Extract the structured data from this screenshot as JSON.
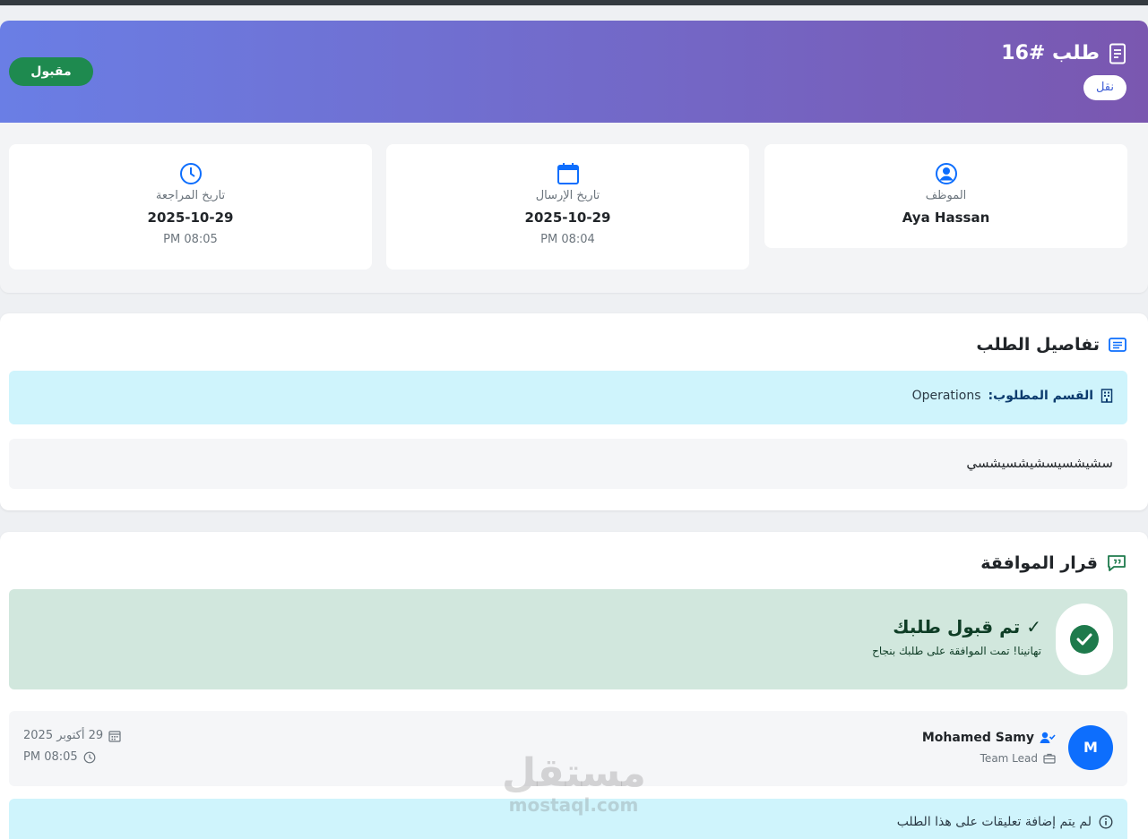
{
  "header": {
    "title": "طلب #16",
    "type_badge": "نقل",
    "status": "مقبول",
    "colors": {
      "gradient_start": "#6a7ee5",
      "gradient_end": "#7a57b0",
      "status_green": "#1e8a4f"
    }
  },
  "info_cards": {
    "employee": {
      "icon": "user-circle-icon",
      "label": "الموظف",
      "value": "Aya Hassan"
    },
    "submitted": {
      "icon": "calendar-icon",
      "label": "تاريخ الإرسال",
      "date": "2025-10-29",
      "time": "PM 08:04"
    },
    "reviewed": {
      "icon": "clock-icon",
      "label": "تاريخ المراجعة",
      "date": "2025-10-29",
      "time": "PM 08:05"
    }
  },
  "details": {
    "title": "تفاصيل الطلب",
    "department_label": "القسم المطلوب:",
    "department_value": "Operations",
    "description": "سشيشسيسشيشسيشسي"
  },
  "decision": {
    "title": "قرار الموافقة",
    "status_title": "✓ تم قبول طلبك",
    "status_message": "تهانينا! تمت الموافقة على طلبك بنجاح",
    "reviewer": {
      "initial": "M",
      "name": "Mohamed Samy",
      "role": "Team Lead",
      "date": "29 أكتوبر 2025",
      "time": "PM 08:05"
    },
    "no_comments": "لم يتم إضافة تعليقات على هذا الطلب"
  },
  "watermark": {
    "arabic": "مستقل",
    "latin": "mostaql.com"
  }
}
